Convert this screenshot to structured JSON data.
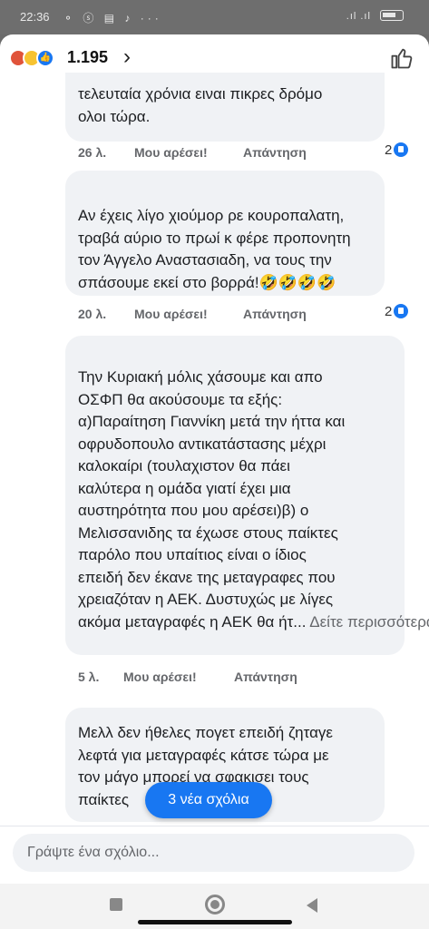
{
  "status_bar": {
    "time": "22:36",
    "icons_left": "⚬ ⓢ ▤ ♪ ···",
    "signal": ".ıl .ıl"
  },
  "reactions": {
    "count": "1.195",
    "icons": [
      "angry-reaction",
      "haha-reaction",
      "like-reaction"
    ]
  },
  "comments": [
    {
      "lines": [
        "τελευταία χρόνια ειναι πικρες δρόμο",
        "ολοι τώρα."
      ],
      "time": "26 λ.",
      "like_label": "Μου αρέσει!",
      "reply_label": "Απάντηση",
      "like_count": "2"
    },
    {
      "lines": [
        "Αν έχεις λίγο χιούμορ ρε κουροπαλατη,",
        "τραβά αύριο το πρωί κ φέρε προπονητη",
        "τον Άγγελο Αναστασιαδη, να τους την",
        "σπάσουμε εκεί στο βορρά!🤣🤣🤣🤣"
      ],
      "time": "20 λ.",
      "like_label": "Μου αρέσει!",
      "reply_label": "Απάντηση",
      "like_count": "2"
    },
    {
      "lines": [
        "Την Κυριακή μόλις χάσουμε και απο",
        "ΟΣΦΠ  θα ακούσουμε τα εξής:",
        "α)Παραίτηση Γιαννίκη μετά την ήττα και",
        "οφρυδοπουλο αντικατάστασης μέχρι",
        "καλοκαίρι (τουλαχιστον θα πάει",
        "καλύτερα η ομάδα γιατί έχει μια",
        "αυστηρότητα που μου αρέσει)β) ο",
        "Μελισσανιδης τα έχωσε στους παίκτες",
        "παρόλο που υπαίτιος είναι ο ίδιος",
        "επειδή δεν έκανε της μεταγραφες που",
        "χρειαζόταν η ΑΕΚ.  Δυστυχώς με λίγες",
        "ακόμα μεταγραφές η ΑΕΚ θα ήτ..."
      ],
      "see_more": "Δείτε περισσότερα",
      "time": "5 λ.",
      "like_label": "Μου αρέσει!",
      "reply_label": "Απάντηση"
    },
    {
      "lines": [
        "Μελλ δεν ήθελες πογετ επειδή ζηταγε",
        "λεφτά για μεταγραφές κάτσε τώρα με",
        "τον μάγο μπορεί να σφακισει τους",
        "παίκτες"
      ]
    }
  ],
  "new_comments_pill": "3 νέα σχόλια",
  "composer": {
    "placeholder": "Γράψτε ένα σχόλιο..."
  },
  "colors": {
    "accent": "#1877f2",
    "bubble": "#f0f2f5",
    "meta_text": "#65676b"
  }
}
